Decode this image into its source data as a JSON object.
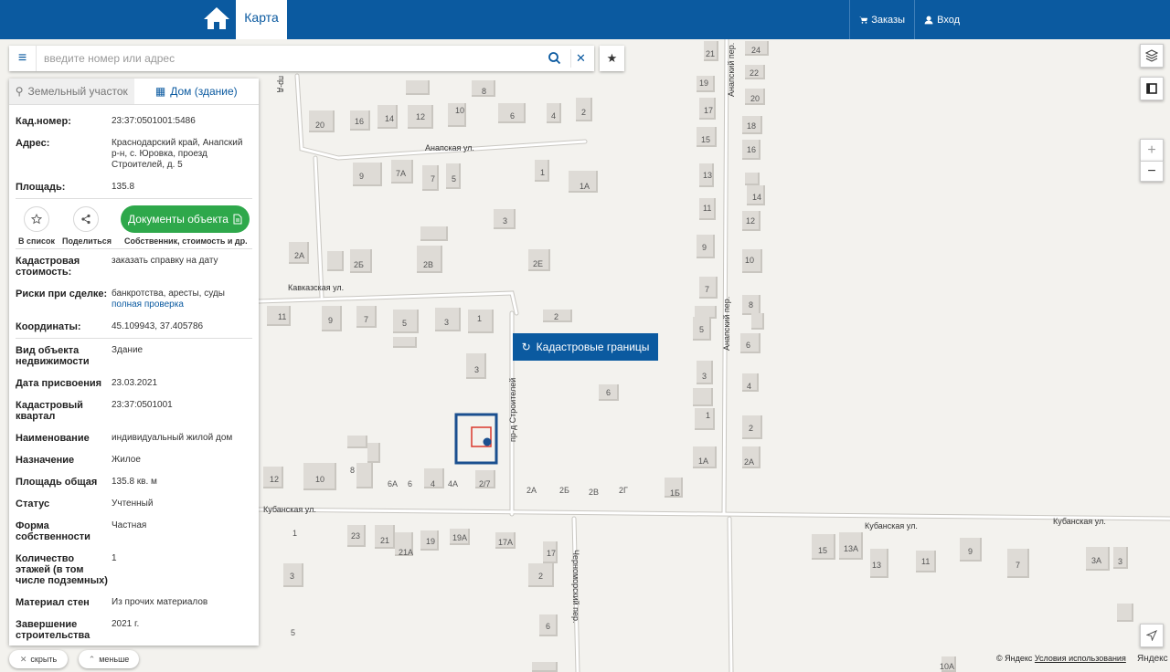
{
  "topbar": {
    "home_icon": "home-icon",
    "tab_map": "Карта",
    "orders": "Заказы",
    "login": "Вход"
  },
  "search": {
    "placeholder": "введите номер или адрес",
    "menu_icon": "menu-icon",
    "search_icon": "search-icon",
    "clear_icon": "close-icon",
    "favorite_icon": "star-icon"
  },
  "panel": {
    "tabs": [
      {
        "label": "Земельный участок",
        "icon": "land-icon",
        "active": false
      },
      {
        "label": "Дом (здание)",
        "icon": "building-icon",
        "active": true
      }
    ],
    "summary": {
      "kad_number_label": "Кад.номер:",
      "kad_number": "23:37:0501001:5486",
      "address_label": "Адрес:",
      "address": "Краснодарский край, Анапский р-н, с. Юровка, проезд Строителей, д. 5",
      "area_label": "Площадь:",
      "area": "135.8"
    },
    "actions": {
      "add_to_list": "В список",
      "share": "Поделиться",
      "docs_button": "Документы объекта",
      "docs_caption": "Собственник, стоимость и др."
    },
    "cost": {
      "label": "Кадастровая стоимость:",
      "link": "заказать справку на дату"
    },
    "risks": {
      "label": "Риски при сделке:",
      "text": "банкротства, аресты, суды",
      "link": "полная проверка"
    },
    "coords": {
      "label": "Координаты:",
      "value": "45.109943, 37.405786"
    },
    "details": [
      {
        "k": "Вид объекта недвижимости",
        "v": "Здание"
      },
      {
        "k": "Дата присвоения",
        "v": "23.03.2021"
      },
      {
        "k": "Кадастровый квартал",
        "v": "23:37:0501001"
      },
      {
        "k": "Наименование",
        "v": "индивидуальный жилой дом"
      },
      {
        "k": "Назначение",
        "v": "Жилое"
      },
      {
        "k": "Площадь общая",
        "v": "135.8 кв. м"
      },
      {
        "k": "Статус",
        "v": "Учтенный"
      },
      {
        "k": "Форма собственности",
        "v": "Частная"
      },
      {
        "k": "Количество этажей (в том числе подземных)",
        "v": "1"
      },
      {
        "k": "Материал стен",
        "v": "Из прочих материалов"
      },
      {
        "k": "Завершение строительства",
        "v": "2021 г."
      }
    ]
  },
  "bottom": {
    "hide": "скрыть",
    "less": "меньше"
  },
  "map": {
    "kad_button": "Кадастровые границы",
    "streets": [
      "пр-д",
      "Анапская ул.",
      "Кавказская ул.",
      "Кубанская ул.",
      "Кубанская ул.",
      "Кубанская ул.",
      "пр-д Строителей",
      "Анапский пер.",
      "Анапский пер.",
      "Черноморский пер."
    ],
    "house_numbers": [
      "8",
      "10",
      "6",
      "4",
      "2",
      "20",
      "16",
      "14",
      "12",
      "9",
      "7А",
      "7",
      "5",
      "1",
      "1А",
      "3",
      "2А",
      "2Б",
      "2В",
      "2Е",
      "11",
      "9",
      "7",
      "5",
      "3",
      "1",
      "2",
      "3",
      "6",
      "8",
      "10",
      "6А",
      "6",
      "4",
      "4А",
      "2/7",
      "2А",
      "2Б",
      "2В",
      "2Г",
      "1Б",
      "12",
      "1",
      "23",
      "21",
      "21А",
      "19",
      "19А",
      "17А",
      "17",
      "2",
      "3",
      "6",
      "5",
      "10А",
      "24",
      "22",
      "20",
      "18",
      "16",
      "14",
      "12",
      "10",
      "8",
      "6",
      "4",
      "2",
      "2А",
      "21",
      "19",
      "17",
      "15",
      "13",
      "11",
      "9",
      "7",
      "5",
      "3",
      "1",
      "1А",
      "15",
      "13А",
      "13",
      "11",
      "9",
      "7",
      "3А",
      "3"
    ],
    "attribution": "© Яндекс",
    "terms": "Условия использования",
    "yandex": "Яндекс",
    "colors": {
      "accent": "#0b5aa0",
      "green": "#2ea84b",
      "parcel": "#1a4f8f",
      "building": "#d9372b"
    }
  }
}
